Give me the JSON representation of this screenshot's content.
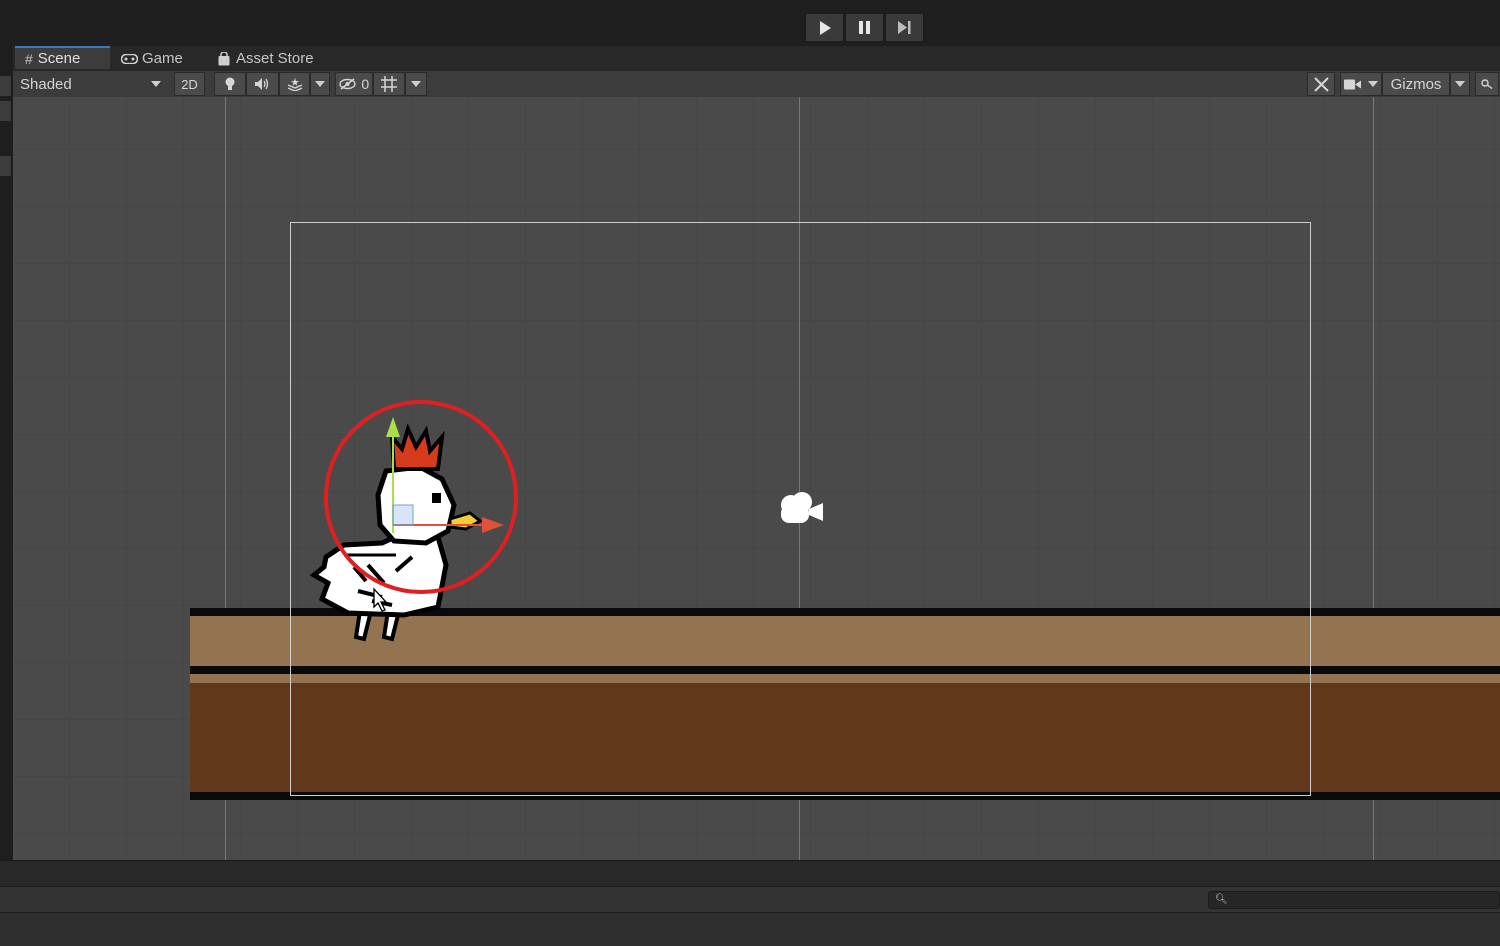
{
  "playbar": {
    "play_icon": "play-icon",
    "pause_icon": "pause-icon",
    "step_icon": "step-icon"
  },
  "tabs": [
    {
      "label": "Scene",
      "icon": "grid-icon",
      "active": true
    },
    {
      "label": "Game",
      "icon": "gamepad-icon",
      "active": false
    },
    {
      "label": "Asset Store",
      "icon": "shopping-bag-icon",
      "active": false
    }
  ],
  "toolbar": {
    "draw_mode": "Shaded",
    "mode_2d": "2D",
    "hidden_count": "0",
    "gizmos_label": "Gizmos"
  },
  "scene": {
    "objects": [
      "chicken-sprite",
      "camera-gizmo",
      "ground-platform"
    ],
    "highlight_color": "#e02020",
    "ground_colors": {
      "light": "#947350",
      "dark": "#62381b",
      "outline": "#0a0a0a"
    }
  },
  "bottom": {
    "search_placeholder": ""
  }
}
